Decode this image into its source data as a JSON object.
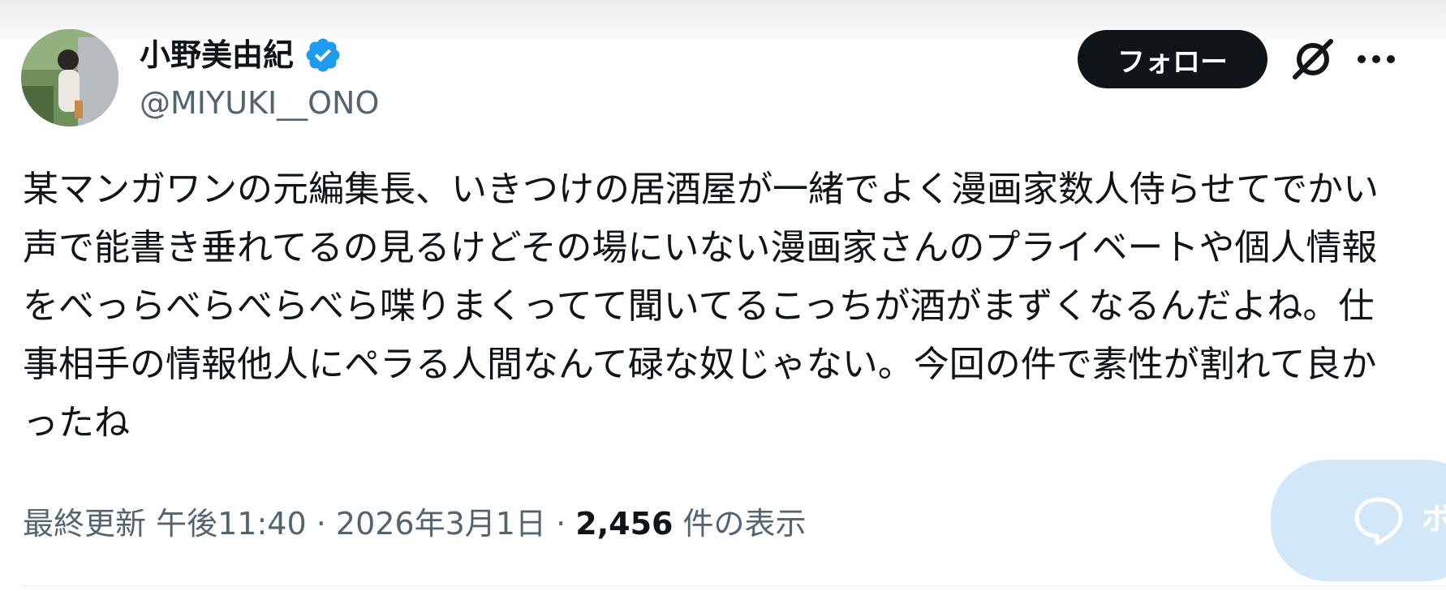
{
  "author": {
    "display_name": "小野美由紀",
    "handle": "@MIYUKI__ONO",
    "verified": true
  },
  "actions": {
    "follow_label": "フォロー",
    "grok_icon": "grok-icon",
    "more_icon": "more-icon"
  },
  "tweet": {
    "text": "某マンガワンの元編集長、いきつけの居酒屋が一緒でよく漫画家数人侍らせてでかい声で能書き垂れてるの見るけどその場にいない漫画家さんのプライベートや個人情報をべっらべらべらべら喋りまくってて聞いてるこっちが酒がまずくなるんだよね。仕事相手の情報他人にペラる人間なんて碌な奴じゃない。今回の件で素性が割れて良かったね"
  },
  "meta": {
    "updated_label": "最終更新",
    "time": "午後11:40",
    "separator": "·",
    "date": "2026年3月1日",
    "views_count": "2,456",
    "views_label": "件の表示"
  },
  "reply": {
    "label": "ボ"
  },
  "colors": {
    "text": "#0f1419",
    "secondary": "#536471",
    "verified_blue": "#1d9bf0",
    "reply_pill": "#d2e8f9"
  }
}
